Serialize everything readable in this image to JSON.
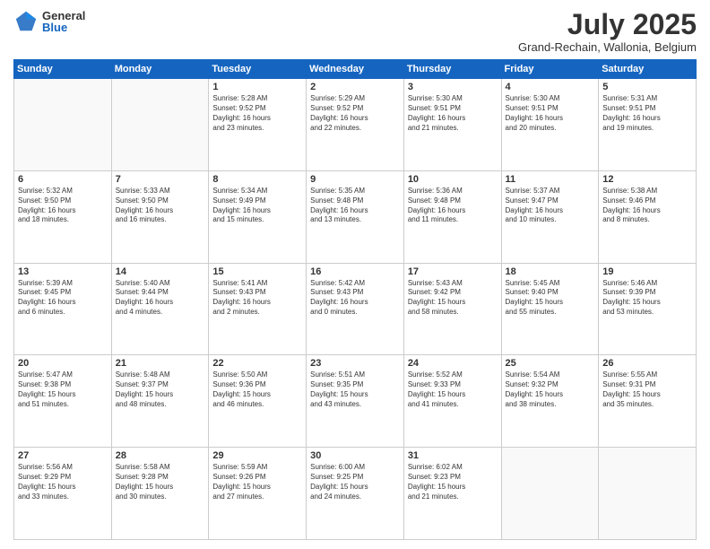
{
  "header": {
    "logo_general": "General",
    "logo_blue": "Blue",
    "title": "July 2025",
    "subtitle": "Grand-Rechain, Wallonia, Belgium"
  },
  "weekdays": [
    "Sunday",
    "Monday",
    "Tuesday",
    "Wednesday",
    "Thursday",
    "Friday",
    "Saturday"
  ],
  "weeks": [
    [
      {
        "day": "",
        "text": ""
      },
      {
        "day": "",
        "text": ""
      },
      {
        "day": "1",
        "text": "Sunrise: 5:28 AM\nSunset: 9:52 PM\nDaylight: 16 hours\nand 23 minutes."
      },
      {
        "day": "2",
        "text": "Sunrise: 5:29 AM\nSunset: 9:52 PM\nDaylight: 16 hours\nand 22 minutes."
      },
      {
        "day": "3",
        "text": "Sunrise: 5:30 AM\nSunset: 9:51 PM\nDaylight: 16 hours\nand 21 minutes."
      },
      {
        "day": "4",
        "text": "Sunrise: 5:30 AM\nSunset: 9:51 PM\nDaylight: 16 hours\nand 20 minutes."
      },
      {
        "day": "5",
        "text": "Sunrise: 5:31 AM\nSunset: 9:51 PM\nDaylight: 16 hours\nand 19 minutes."
      }
    ],
    [
      {
        "day": "6",
        "text": "Sunrise: 5:32 AM\nSunset: 9:50 PM\nDaylight: 16 hours\nand 18 minutes."
      },
      {
        "day": "7",
        "text": "Sunrise: 5:33 AM\nSunset: 9:50 PM\nDaylight: 16 hours\nand 16 minutes."
      },
      {
        "day": "8",
        "text": "Sunrise: 5:34 AM\nSunset: 9:49 PM\nDaylight: 16 hours\nand 15 minutes."
      },
      {
        "day": "9",
        "text": "Sunrise: 5:35 AM\nSunset: 9:48 PM\nDaylight: 16 hours\nand 13 minutes."
      },
      {
        "day": "10",
        "text": "Sunrise: 5:36 AM\nSunset: 9:48 PM\nDaylight: 16 hours\nand 11 minutes."
      },
      {
        "day": "11",
        "text": "Sunrise: 5:37 AM\nSunset: 9:47 PM\nDaylight: 16 hours\nand 10 minutes."
      },
      {
        "day": "12",
        "text": "Sunrise: 5:38 AM\nSunset: 9:46 PM\nDaylight: 16 hours\nand 8 minutes."
      }
    ],
    [
      {
        "day": "13",
        "text": "Sunrise: 5:39 AM\nSunset: 9:45 PM\nDaylight: 16 hours\nand 6 minutes."
      },
      {
        "day": "14",
        "text": "Sunrise: 5:40 AM\nSunset: 9:44 PM\nDaylight: 16 hours\nand 4 minutes."
      },
      {
        "day": "15",
        "text": "Sunrise: 5:41 AM\nSunset: 9:43 PM\nDaylight: 16 hours\nand 2 minutes."
      },
      {
        "day": "16",
        "text": "Sunrise: 5:42 AM\nSunset: 9:43 PM\nDaylight: 16 hours\nand 0 minutes."
      },
      {
        "day": "17",
        "text": "Sunrise: 5:43 AM\nSunset: 9:42 PM\nDaylight: 15 hours\nand 58 minutes."
      },
      {
        "day": "18",
        "text": "Sunrise: 5:45 AM\nSunset: 9:40 PM\nDaylight: 15 hours\nand 55 minutes."
      },
      {
        "day": "19",
        "text": "Sunrise: 5:46 AM\nSunset: 9:39 PM\nDaylight: 15 hours\nand 53 minutes."
      }
    ],
    [
      {
        "day": "20",
        "text": "Sunrise: 5:47 AM\nSunset: 9:38 PM\nDaylight: 15 hours\nand 51 minutes."
      },
      {
        "day": "21",
        "text": "Sunrise: 5:48 AM\nSunset: 9:37 PM\nDaylight: 15 hours\nand 48 minutes."
      },
      {
        "day": "22",
        "text": "Sunrise: 5:50 AM\nSunset: 9:36 PM\nDaylight: 15 hours\nand 46 minutes."
      },
      {
        "day": "23",
        "text": "Sunrise: 5:51 AM\nSunset: 9:35 PM\nDaylight: 15 hours\nand 43 minutes."
      },
      {
        "day": "24",
        "text": "Sunrise: 5:52 AM\nSunset: 9:33 PM\nDaylight: 15 hours\nand 41 minutes."
      },
      {
        "day": "25",
        "text": "Sunrise: 5:54 AM\nSunset: 9:32 PM\nDaylight: 15 hours\nand 38 minutes."
      },
      {
        "day": "26",
        "text": "Sunrise: 5:55 AM\nSunset: 9:31 PM\nDaylight: 15 hours\nand 35 minutes."
      }
    ],
    [
      {
        "day": "27",
        "text": "Sunrise: 5:56 AM\nSunset: 9:29 PM\nDaylight: 15 hours\nand 33 minutes."
      },
      {
        "day": "28",
        "text": "Sunrise: 5:58 AM\nSunset: 9:28 PM\nDaylight: 15 hours\nand 30 minutes."
      },
      {
        "day": "29",
        "text": "Sunrise: 5:59 AM\nSunset: 9:26 PM\nDaylight: 15 hours\nand 27 minutes."
      },
      {
        "day": "30",
        "text": "Sunrise: 6:00 AM\nSunset: 9:25 PM\nDaylight: 15 hours\nand 24 minutes."
      },
      {
        "day": "31",
        "text": "Sunrise: 6:02 AM\nSunset: 9:23 PM\nDaylight: 15 hours\nand 21 minutes."
      },
      {
        "day": "",
        "text": ""
      },
      {
        "day": "",
        "text": ""
      }
    ]
  ]
}
